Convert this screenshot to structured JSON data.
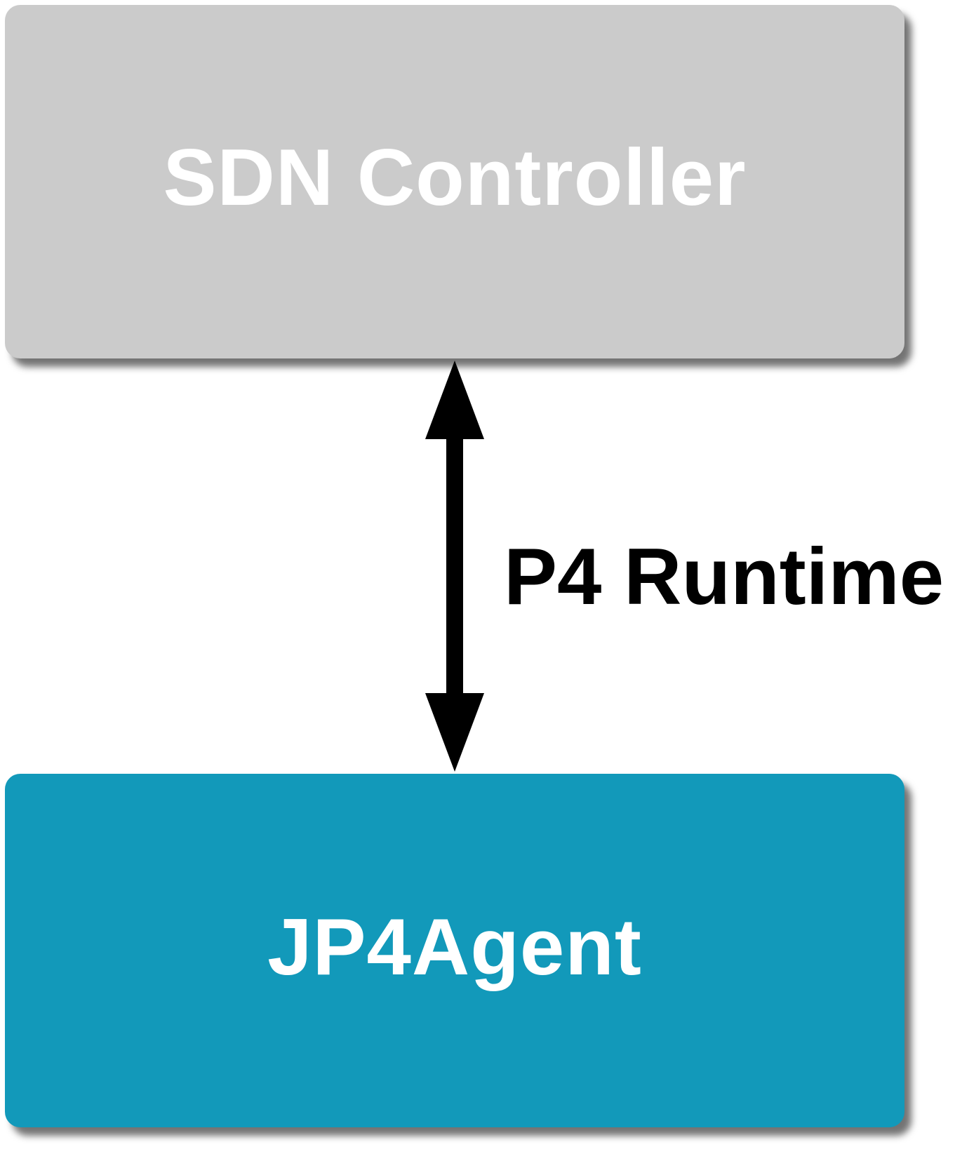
{
  "diagram": {
    "top_node": {
      "label": "SDN Controller",
      "color": "#cbcbcb"
    },
    "bottom_node": {
      "label": "JP4Agent",
      "color": "#1299ba"
    },
    "link": {
      "label": "P4 Runtime",
      "direction": "bidirectional",
      "color": "#000000"
    }
  }
}
